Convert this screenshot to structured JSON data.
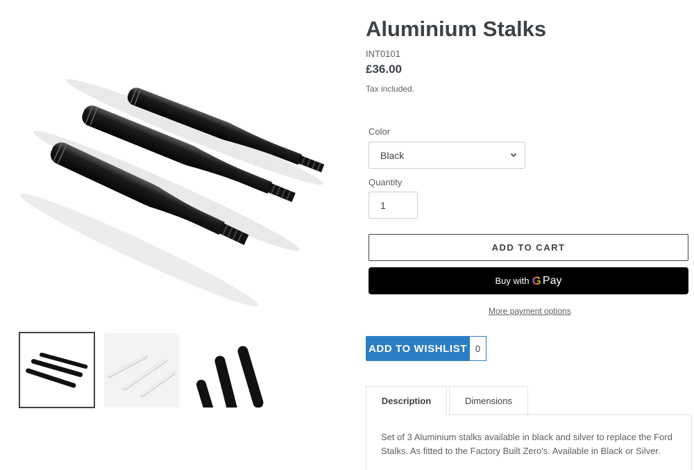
{
  "product": {
    "title": "Aluminium Stalks",
    "sku": "INT0101",
    "price": "£36.00",
    "tax_note": "Tax included."
  },
  "gallery": {
    "main_image": "black-aluminium-stalks-photo",
    "thumbnails": [
      {
        "image": "black-stalks-thumbnail",
        "selected": true
      },
      {
        "image": "silver-stalks-thumbnail",
        "selected": false
      },
      {
        "image": "black-stalks-closeup-thumbnail",
        "selected": false
      }
    ]
  },
  "options": {
    "color_label": "Color",
    "color_value": "Black",
    "quantity_label": "Quantity",
    "quantity_value": "1"
  },
  "actions": {
    "add_to_cart": "ADD TO CART",
    "gpay_buy_with": "Buy with",
    "gpay_g": "G",
    "gpay_pay": "Pay",
    "more_payment_options": "More payment options",
    "wishlist_label": "ADD TO WISHLIST",
    "wishlist_count": "0"
  },
  "tabs": [
    {
      "label": "Description",
      "active": true
    },
    {
      "label": "Dimensions",
      "active": false
    }
  ],
  "description": "Set of 3 Aluminium stalks available in black and silver to replace the Ford Stalks. As fitted to the Factory Built Zero's. Available in Black or Silver.",
  "colors": {
    "text": "#3d4246",
    "wishlist_blue": "#2b7dc5",
    "gpay_black": "#000000"
  }
}
